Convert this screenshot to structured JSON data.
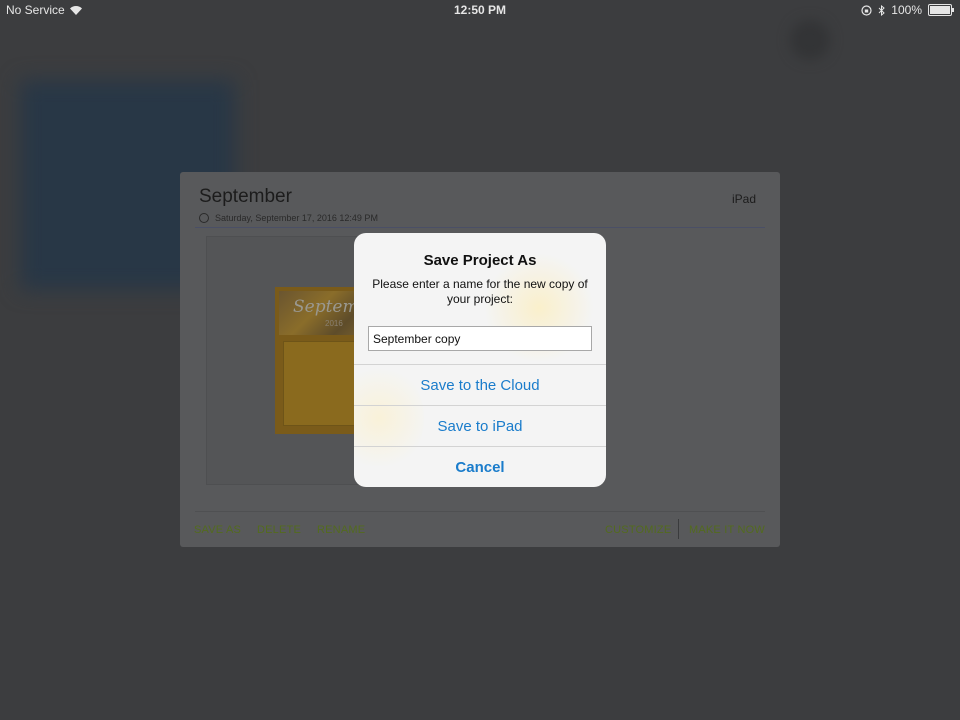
{
  "status_bar": {
    "carrier": "No Service",
    "time": "12:50 PM",
    "battery": "100%",
    "icons": [
      "wifi-icon",
      "orientation-lock-icon",
      "bluetooth-icon",
      "battery-icon"
    ]
  },
  "project": {
    "title": "September",
    "device": "iPad",
    "date": "Saturday, September 17, 2016 12:49 PM",
    "thumbnail_text": "Septemb",
    "thumbnail_sub": "2016",
    "actions_left": [
      "SAVE AS",
      "DELETE",
      "RENAME"
    ],
    "actions_right": [
      "CUSTOMIZE",
      "MAKE IT NOW"
    ]
  },
  "dialog": {
    "title": "Save Project As",
    "message": "Please enter a name for the new copy of your project:",
    "input_value": "September copy",
    "buttons": [
      "Save to the Cloud",
      "Save to iPad",
      "Cancel"
    ]
  },
  "colors": {
    "action_green": "#536b1e",
    "ios_blue": "#1a7ccb",
    "overlay": "#3c3d3f"
  }
}
